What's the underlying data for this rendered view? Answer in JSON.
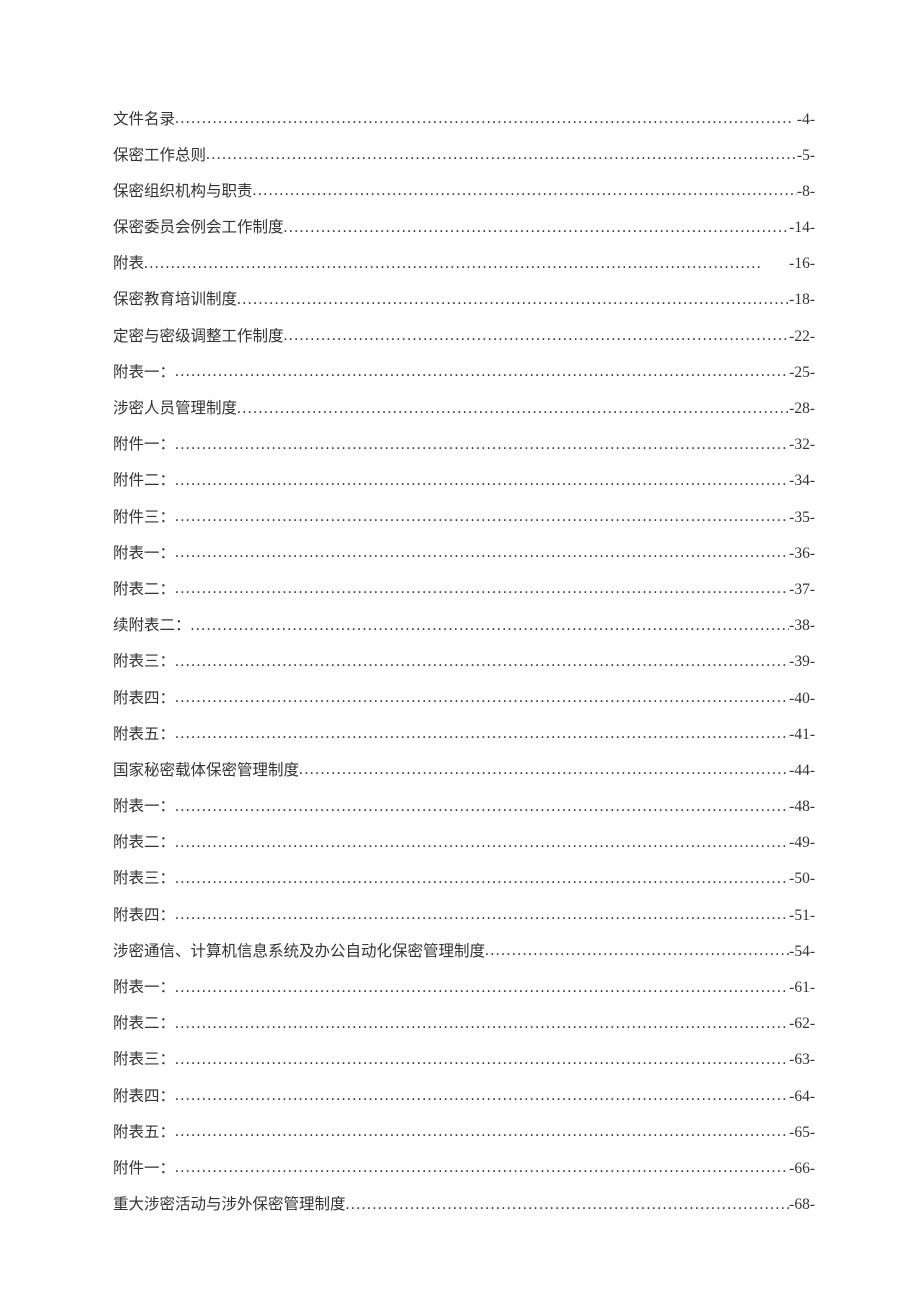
{
  "toc": {
    "entries": [
      {
        "title": "文件名录",
        "page": "-4-"
      },
      {
        "title": "保密工作总则",
        "page": "-5-"
      },
      {
        "title": "保密组织机构与职责",
        "page": "-8-"
      },
      {
        "title": "保密委员会例会工作制度",
        "page": "-14-"
      },
      {
        "title": "附表",
        "page": "-16-"
      },
      {
        "title": "保密教育培训制度",
        "page": "-18-"
      },
      {
        "title": "定密与密级调整工作制度",
        "page": "-22-"
      },
      {
        "title": "附表一：",
        "page": "-25-"
      },
      {
        "title": "涉密人员管理制度",
        "page": "-28-"
      },
      {
        "title": "附件一：",
        "page": "-32-"
      },
      {
        "title": "附件二：",
        "page": "-34-"
      },
      {
        "title": "附件三：",
        "page": "-35-"
      },
      {
        "title": "附表一：",
        "page": "-36-"
      },
      {
        "title": "附表二：",
        "page": "-37-"
      },
      {
        "title": "续附表二：",
        "page": "-38-"
      },
      {
        "title": "附表三：",
        "page": "-39-"
      },
      {
        "title": "附表四：",
        "page": "-40-"
      },
      {
        "title": "附表五：",
        "page": "-41-"
      },
      {
        "title": "国家秘密载体保密管理制度",
        "page": "-44-"
      },
      {
        "title": "附表一：",
        "page": "-48-"
      },
      {
        "title": "附表二：",
        "page": "-49-"
      },
      {
        "title": "附表三：",
        "page": "-50-"
      },
      {
        "title": "附表四：",
        "page": "-51-"
      },
      {
        "title": "涉密通信、计算机信息系统及办公自动化保密管理制度",
        "page": "-54-"
      },
      {
        "title": "附表一：",
        "page": "-61-"
      },
      {
        "title": "附表二：",
        "page": "-62-"
      },
      {
        "title": "附表三：",
        "page": "-63-"
      },
      {
        "title": "附表四：",
        "page": "-64-"
      },
      {
        "title": "附表五：",
        "page": "-65-"
      },
      {
        "title": "附件一：",
        "page": "-66-"
      },
      {
        "title": "重大涉密活动与涉外保密管理制度",
        "page": "-68-"
      }
    ]
  }
}
